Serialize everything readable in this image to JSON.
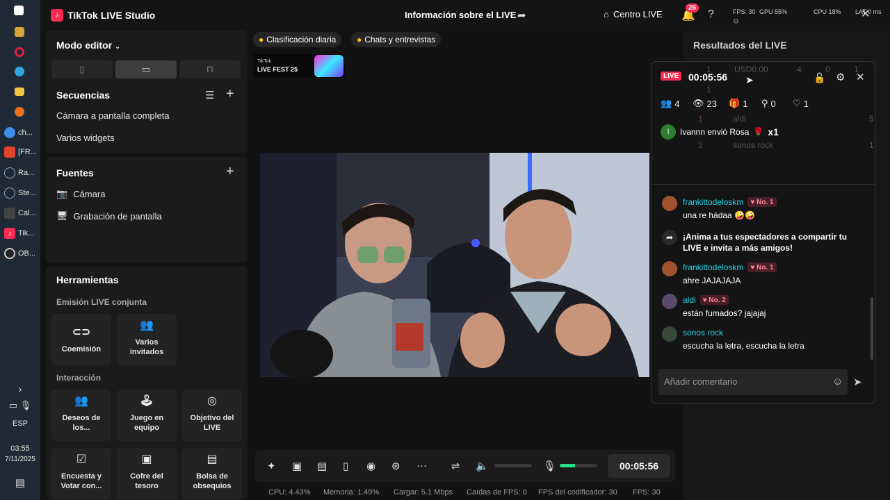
{
  "taskbar": {
    "apps": [
      {
        "name": "windows-start",
        "label": ""
      },
      {
        "name": "calculator",
        "label": ""
      },
      {
        "name": "opera",
        "label": ""
      },
      {
        "name": "edge",
        "label": ""
      },
      {
        "name": "file-explorer",
        "label": ""
      },
      {
        "name": "firefox",
        "label": ""
      },
      {
        "name": "chrome",
        "label": "ch..."
      },
      {
        "name": "brave",
        "label": "[FR..."
      },
      {
        "name": "razer",
        "label": "Ra..."
      },
      {
        "name": "steam",
        "label": "Ste..."
      },
      {
        "name": "calc-window",
        "label": "Cal..."
      },
      {
        "name": "tiktok-window",
        "label": "Tik..."
      },
      {
        "name": "obs",
        "label": "OB..."
      }
    ],
    "lang": "ESP",
    "time": "03:55",
    "date": "7/11/2025"
  },
  "topbar": {
    "app_title": "TikTok LIVE Studio",
    "center_title": "Información sobre el LIVE",
    "centro_live": "Centro LIVE",
    "notif_count": "26",
    "fps": "FPS: 30",
    "gpu": "GPU 55%",
    "cpu": "CPU 18%",
    "lat": "LAT 0 ms"
  },
  "left": {
    "mode": "Modo editor",
    "secuencias_title": "Secuencias",
    "secuencias": [
      "Cámara a pantalla completa",
      "Varios widgets"
    ],
    "fuentes_title": "Fuentes",
    "fuentes": [
      "Cámara",
      "Grabación de pantalla"
    ],
    "tools_title": "Herramientas",
    "emision_label": "Emisión LIVE conjunta",
    "emision_tools": [
      "Coemisión",
      "Varios invitados"
    ],
    "interaccion_label": "Interacción",
    "interaccion_tools": [
      "Deseos de los...",
      "Juego en equipo",
      "Objetivo del LIVE",
      "Encuesta y Votar con...",
      "Cofre del tesoro",
      "Bolsa de obsequios"
    ]
  },
  "center": {
    "pill_ranking": "Clasificación diaria",
    "pill_chats": "Chats y entrevistas",
    "fest_small": "TikTok",
    "fest_big": "LIVE FEST 25",
    "timer": "00:05:56",
    "volume_level": 0,
    "mic_level": 0.4,
    "status": {
      "cpu_label": "CPU:",
      "cpu": "4.43%",
      "mem_label": "Memoria:",
      "mem": "1.49%",
      "load_label": "Cargar:",
      "load": "5.1 Mbps",
      "drop_label": "Caídas de FPS:",
      "drop": "0",
      "enc_label": "FPS del codificador:",
      "enc": "30",
      "fps_label": "FPS:",
      "fps": "30"
    }
  },
  "right": {
    "results_title": "Resultados del LIVE",
    "bg_stats": [
      "1",
      "USD0.00",
      "4",
      "0",
      "1",
      "1"
    ],
    "bg_ranks": [
      {
        "rank": "1",
        "name": "aldi",
        "value": "5"
      },
      {
        "rank": "2",
        "name": "sonos rock",
        "value": "1"
      }
    ],
    "overlay": {
      "live_badge": "LIVE",
      "time": "00:05:56",
      "viewers": "4",
      "views": "23",
      "gifts": "1",
      "shares": "0",
      "likes": "1",
      "gift_user_initial": "I",
      "gift_text": "Ivannn envió Rosa",
      "gift_count": "x1",
      "comments": [
        {
          "name": "frankittodeloskm",
          "badge": "No. 1",
          "text": "una re hádaa 🤪🤪",
          "color": "#a0522d"
        },
        {
          "name": "frankittodeloskm",
          "badge": "No. 1",
          "text": "ahre JAJAJAJA",
          "color": "#a0522d"
        },
        {
          "name": "aldi",
          "badge": "No. 2",
          "text": "están fumados? jajajaj",
          "color": "#5a4a6a"
        },
        {
          "name": "sonos rock",
          "badge": "",
          "text": "escucha la letra, escucha la letra",
          "color": "#3a4a3a"
        }
      ],
      "promo": "¡Anima a tus espectadores a compartir tu LIVE e invita a más amigos!",
      "input_placeholder": "Añadir comentario"
    }
  },
  "colors": {
    "accent": "#fe2c55",
    "cyan": "#20d5ec",
    "bg": "#121212",
    "panel": "#1b1b1b"
  }
}
